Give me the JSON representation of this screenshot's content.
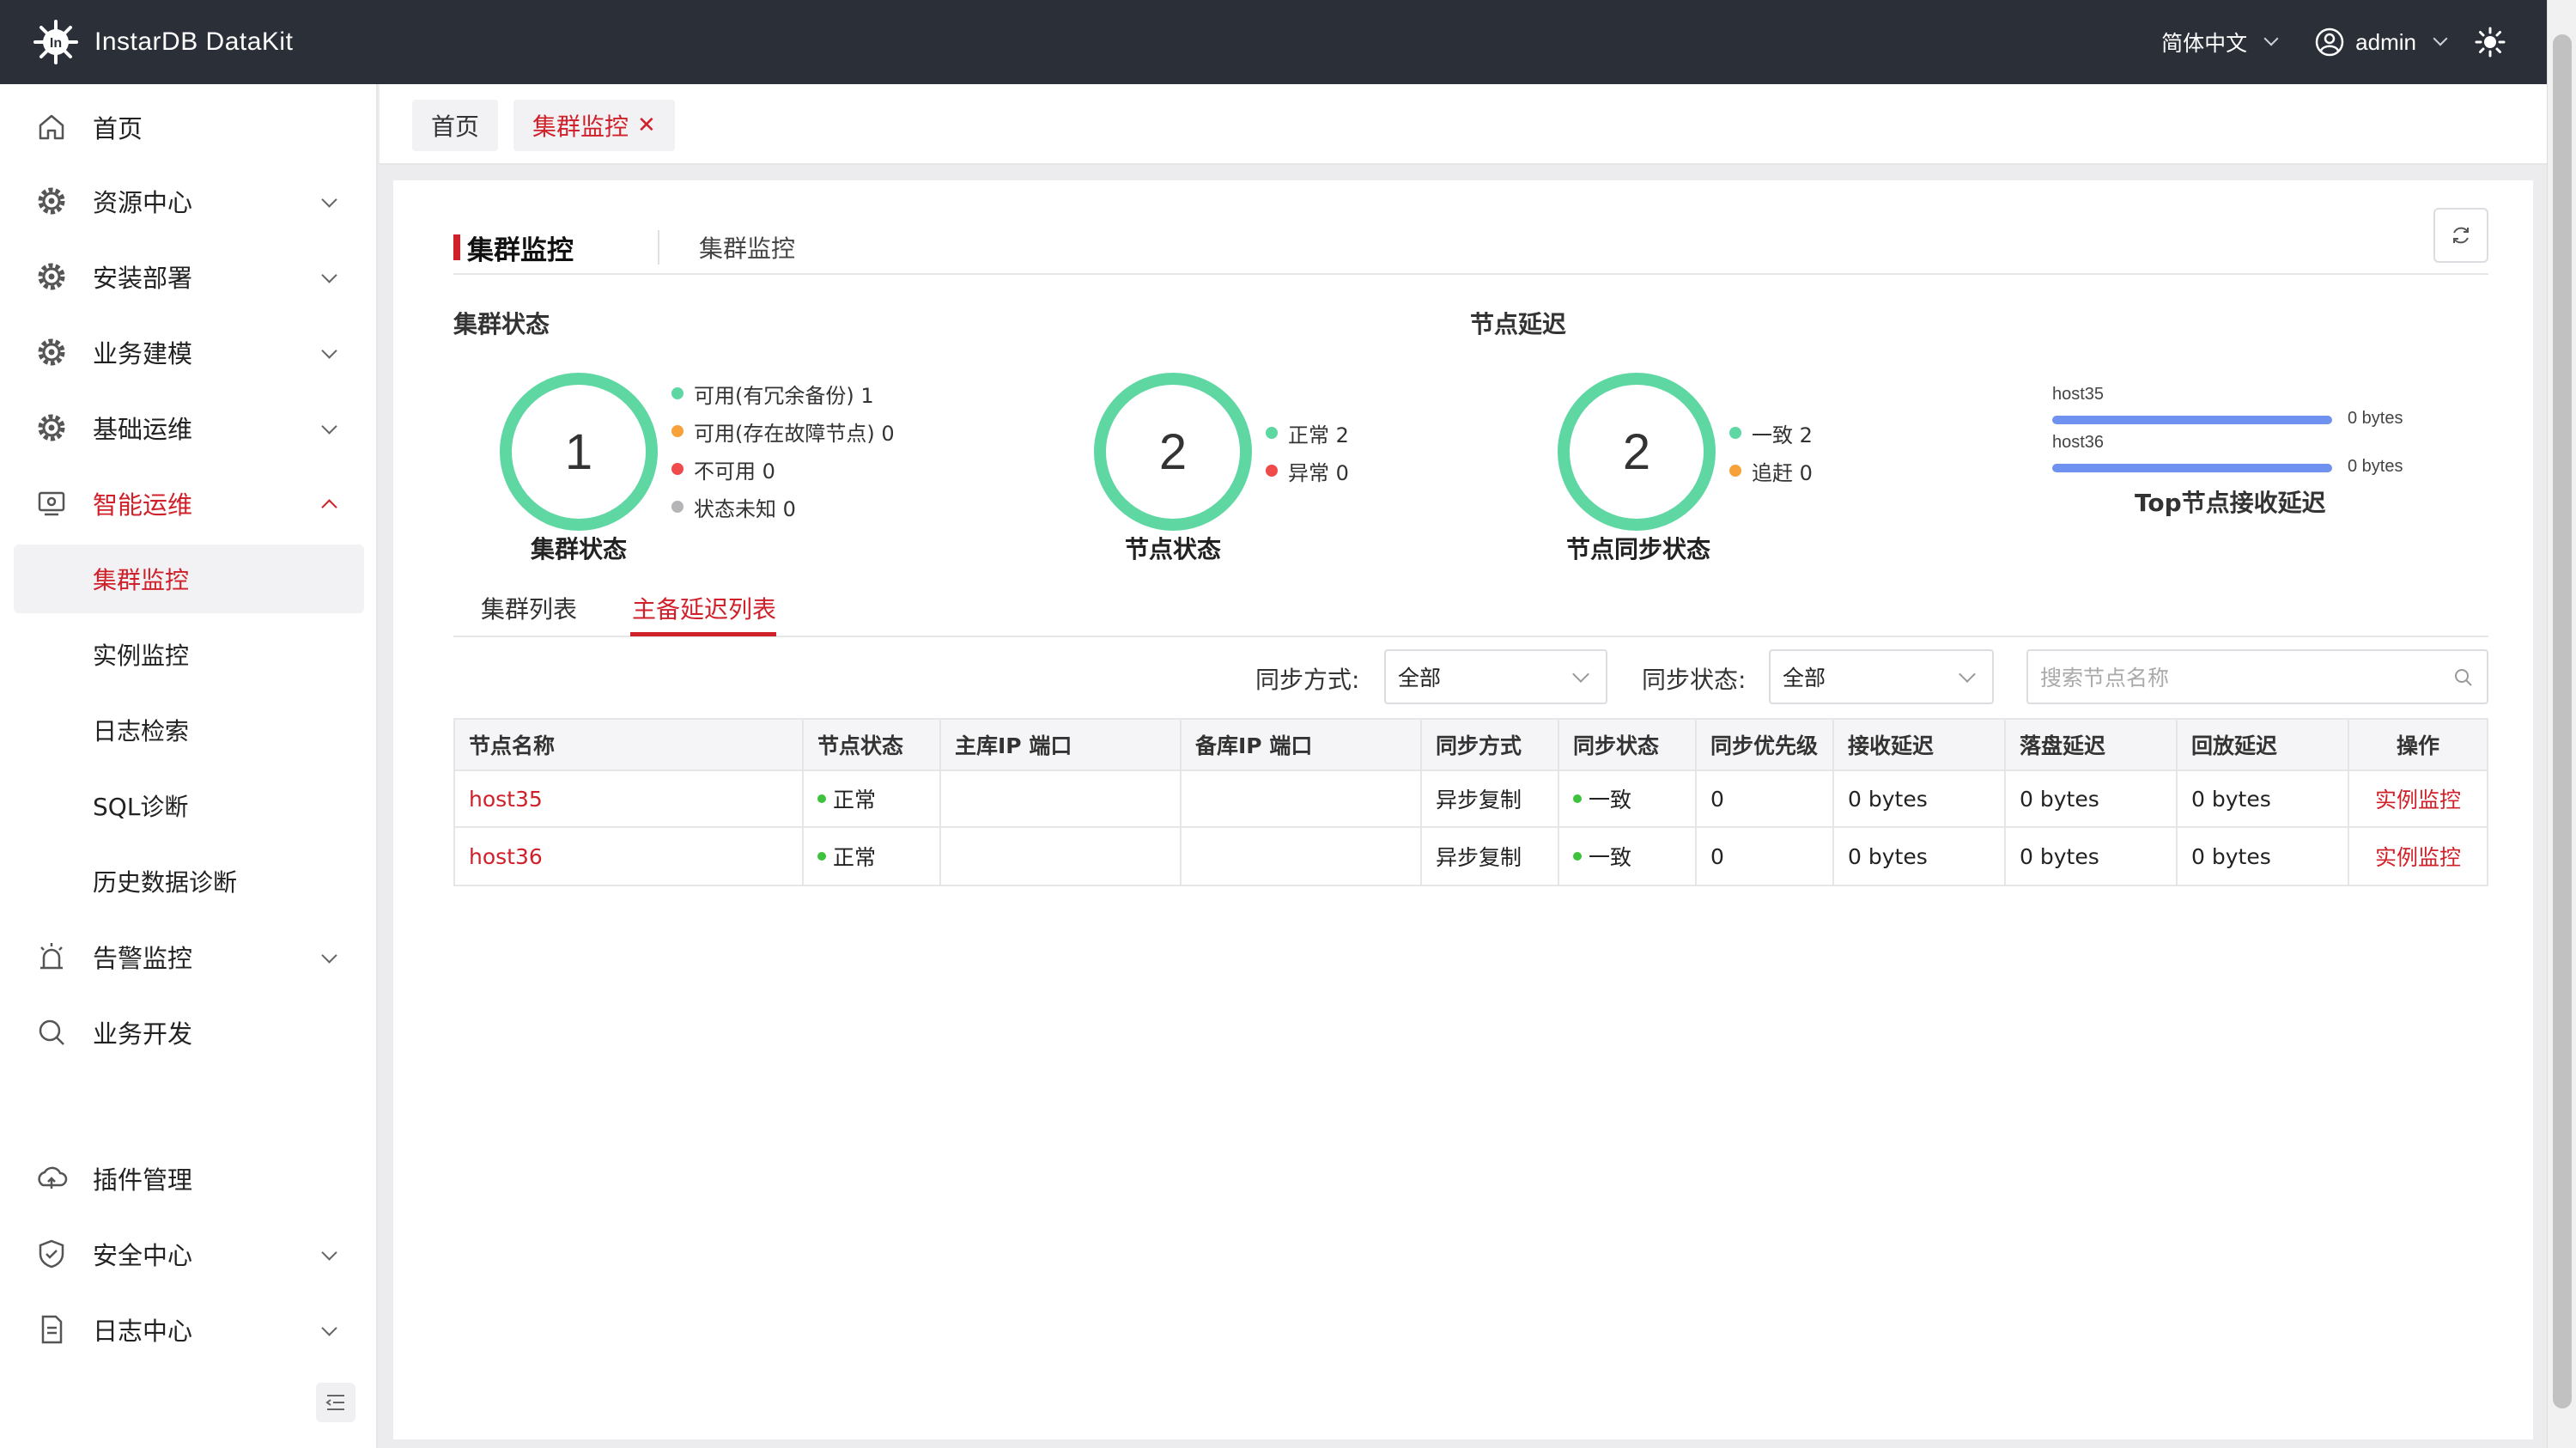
{
  "app": {
    "title": "InstarDB DataKit"
  },
  "topbar": {
    "language": "简体中文",
    "user": "admin"
  },
  "sidebar": {
    "items": [
      {
        "label": "首页",
        "icon": "home-icon"
      },
      {
        "label": "资源中心",
        "icon": "gear-icon"
      },
      {
        "label": "安装部署",
        "icon": "gear-icon"
      },
      {
        "label": "业务建模",
        "icon": "gear-icon"
      },
      {
        "label": "基础运维",
        "icon": "gear-icon"
      },
      {
        "label": "智能运维",
        "icon": "monitor-icon"
      },
      {
        "label": "集群监控"
      },
      {
        "label": "实例监控"
      },
      {
        "label": "日志检索"
      },
      {
        "label": "SQL诊断"
      },
      {
        "label": "历史数据诊断"
      },
      {
        "label": "告警监控",
        "icon": "alarm-icon"
      },
      {
        "label": "业务开发",
        "icon": "search-icon"
      },
      {
        "label": "插件管理",
        "icon": "plugin-icon"
      },
      {
        "label": "安全中心",
        "icon": "shield-icon"
      },
      {
        "label": "日志中心",
        "icon": "document-icon"
      }
    ]
  },
  "tabs": {
    "home": "首页",
    "current": "集群监控"
  },
  "header": {
    "title": "集群监控",
    "subtitle": "集群监控"
  },
  "cluster_status": {
    "section": "集群状态",
    "value": "1",
    "caption": "集群状态",
    "legend": [
      "可用(有冗余备份) 1",
      "可用(存在故障节点) 0",
      "不可用 0",
      "状态未知 0"
    ]
  },
  "node_status": {
    "value": "2",
    "caption": "节点状态",
    "legend": [
      "正常 2",
      "异常 0"
    ]
  },
  "node_delay": {
    "section": "节点延迟",
    "sync_value": "2",
    "sync_caption": "节点同步状态",
    "sync_legend": [
      "一致 2",
      "追赶 0"
    ],
    "bars_title": "Top节点接收延迟",
    "bars": [
      {
        "host": "host35",
        "value": "0 bytes",
        "fraction": 1.0
      },
      {
        "host": "host36",
        "value": "0 bytes",
        "fraction": 1.0
      }
    ]
  },
  "subtabs": [
    "集群列表",
    "主备延迟列表"
  ],
  "filters": {
    "sync_mode_label": "同步方式:",
    "sync_mode_value": "全部",
    "sync_status_label": "同步状态:",
    "sync_status_value": "全部",
    "search_placeholder": "搜索节点名称"
  },
  "table": {
    "columns": [
      "节点名称",
      "节点状态",
      "主库IP 端口",
      "备库IP 端口",
      "同步方式",
      "同步状态",
      "同步优先级",
      "接收延迟",
      "落盘延迟",
      "回放延迟",
      "操作"
    ],
    "rows": [
      [
        "host35",
        "正常",
        "",
        "",
        "异步复制",
        "一致",
        "0",
        "0 bytes",
        "0 bytes",
        "0 bytes",
        "实例监控"
      ],
      [
        "host36",
        "正常",
        "",
        "",
        "异步复制",
        "一致",
        "0",
        "0 bytes",
        "0 bytes",
        "0 bytes",
        "实例监控"
      ]
    ]
  },
  "colors": {
    "accent": "#d0202a",
    "ring": "#5ed7a2",
    "bar": "#6f92f0",
    "topbar": "#2b2f38"
  }
}
